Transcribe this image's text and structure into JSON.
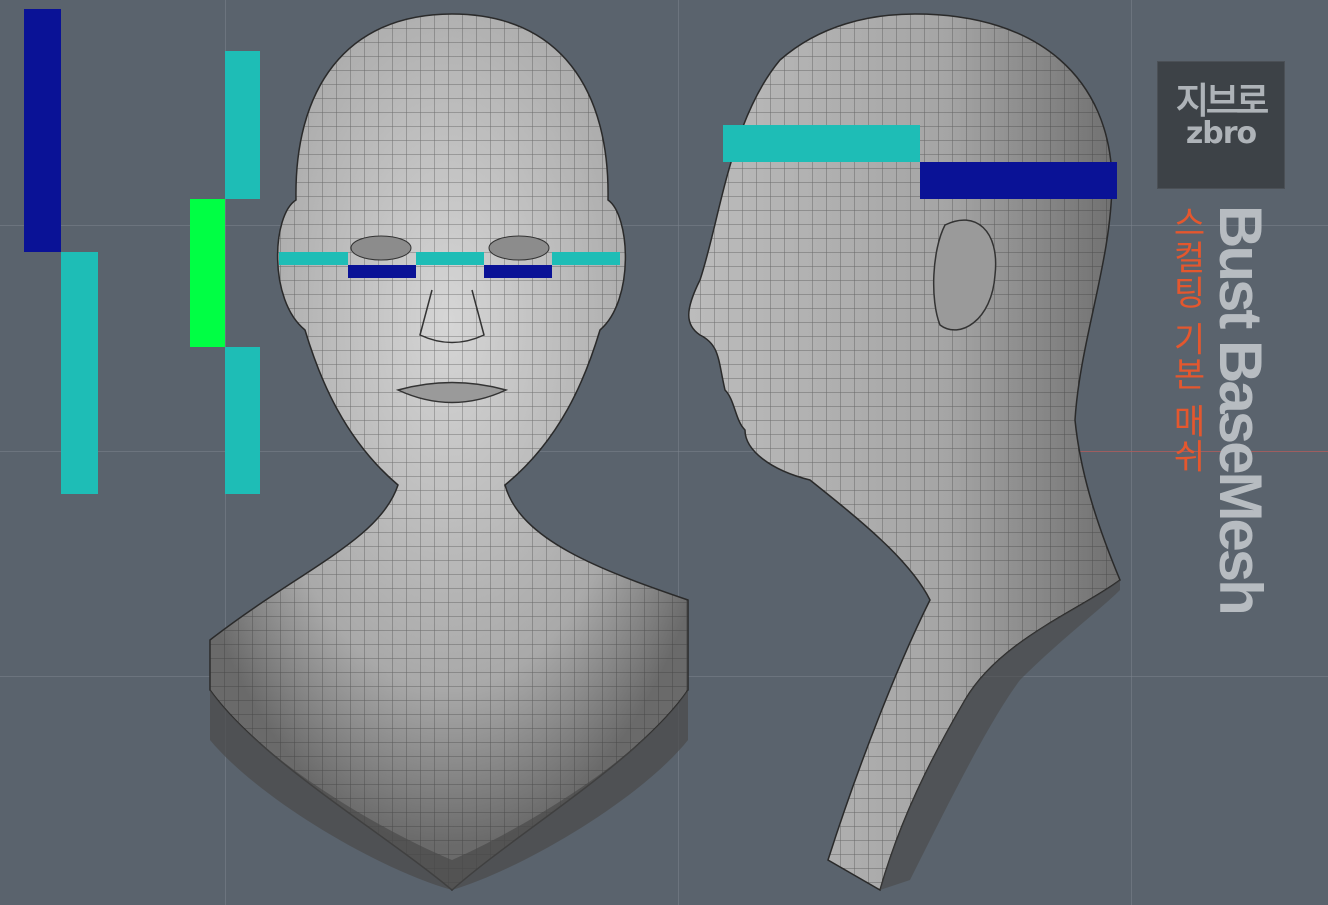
{
  "logo": {
    "korean": "지브로",
    "latin": "zbro"
  },
  "title": "Bust BaseMesh",
  "subtitle": "스컬팅 기본 매쉬",
  "colors": {
    "background": "#5a636d",
    "teal": "#1ebdb6",
    "navy": "#0a1296",
    "green": "#00ff44",
    "accent": "#e4572e",
    "mesh_light": "#c9c9c9",
    "mesh_dark": "#3c3c3c"
  },
  "views": [
    "front-view",
    "side-view"
  ]
}
